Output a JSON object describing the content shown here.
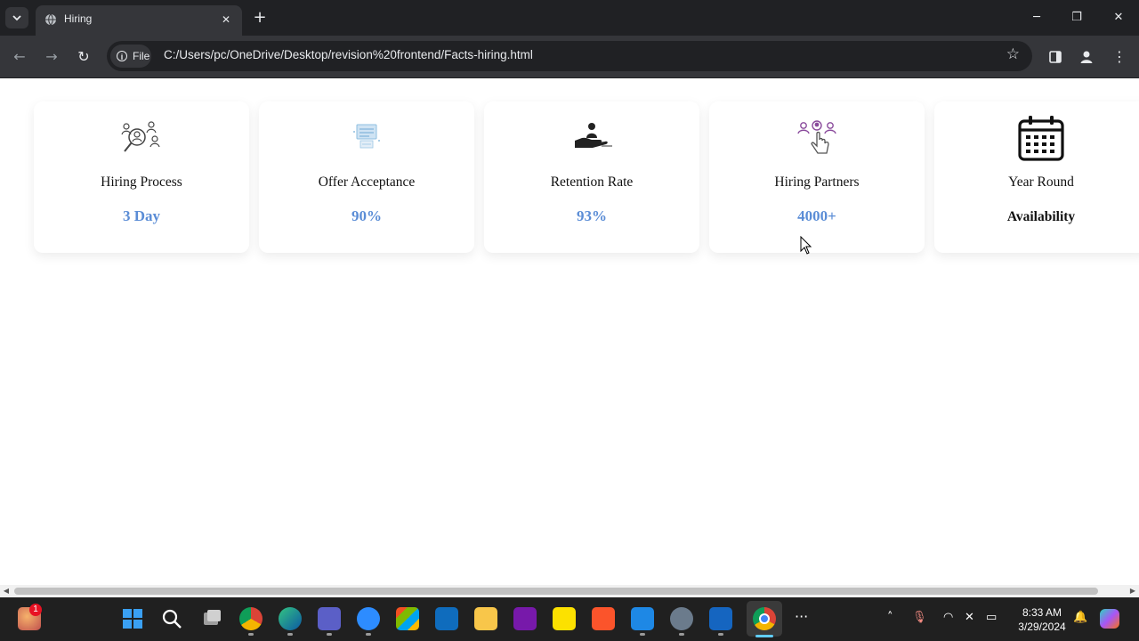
{
  "browser": {
    "tab_title": "Hiring",
    "address_scheme_label": "File",
    "address_url": "C:/Users/pc/OneDrive/Desktop/revision%20frontend/Facts-hiring.html",
    "icons": [
      "tab-search-icon",
      "globe-icon",
      "close-icon",
      "plus-icon",
      "minimize-icon",
      "restore-icon",
      "close-window-icon",
      "back-icon",
      "forward-icon",
      "reload-icon",
      "info-icon",
      "star-icon",
      "side-panel-icon",
      "profile-icon",
      "menu-icon"
    ]
  },
  "cards": [
    {
      "icon": "recruitment-search-icon",
      "label": "Hiring Process",
      "value": "3 Day"
    },
    {
      "icon": "offer-document-icon",
      "label": "Offer Acceptance",
      "value": "90%"
    },
    {
      "icon": "hand-with-person-icon",
      "label": "Retention Rate",
      "value": "93%"
    },
    {
      "icon": "team-select-icon",
      "label": "Hiring Partners",
      "value": "4000+"
    },
    {
      "icon": "calendar-icon",
      "label": "Year Round",
      "value": "Availability"
    }
  ],
  "colors": {
    "accent_value": "#5b8dd6",
    "browser_dark": "#202124",
    "browser_toolbar": "#35363a",
    "taskbar": "#202020"
  },
  "taskbar": {
    "notification_count": "1",
    "time": "8:33 AM",
    "date": "3/29/2024",
    "apps": [
      "widgets-icon",
      "start-icon",
      "search-icon",
      "task-view-icon",
      "chrome-icon",
      "edge-icon",
      "teams-icon",
      "zoom-icon",
      "store-icon",
      "mail-icon",
      "file-explorer-icon",
      "onenote-icon",
      "sticky-notes-icon",
      "brave-icon",
      "vscode-icon",
      "settings-icon",
      "remote-icon",
      "chrome-active-icon",
      "more-icon"
    ]
  }
}
